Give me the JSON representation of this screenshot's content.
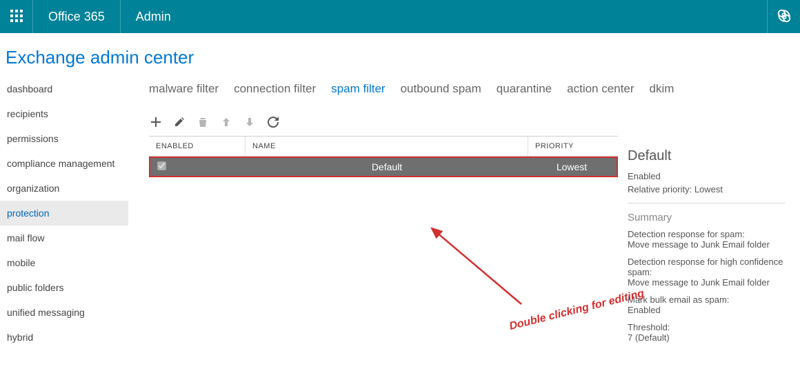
{
  "topbar": {
    "brand": "Office 365",
    "app": "Admin"
  },
  "page_title": "Exchange admin center",
  "sidebar": {
    "items": [
      {
        "label": "dashboard"
      },
      {
        "label": "recipients"
      },
      {
        "label": "permissions"
      },
      {
        "label": "compliance management"
      },
      {
        "label": "organization"
      },
      {
        "label": "protection",
        "active": true
      },
      {
        "label": "mail flow"
      },
      {
        "label": "mobile"
      },
      {
        "label": "public folders"
      },
      {
        "label": "unified messaging"
      },
      {
        "label": "hybrid"
      }
    ]
  },
  "subtabs": {
    "items": [
      {
        "label": "malware filter"
      },
      {
        "label": "connection filter"
      },
      {
        "label": "spam filter",
        "active": true
      },
      {
        "label": "outbound spam"
      },
      {
        "label": "quarantine"
      },
      {
        "label": "action center"
      },
      {
        "label": "dkim"
      }
    ]
  },
  "toolbar": {
    "add": "add",
    "edit": "edit",
    "delete": "delete",
    "move_up": "move up",
    "move_down": "move down",
    "refresh": "refresh"
  },
  "table": {
    "columns": {
      "enabled": "ENABLED",
      "name": "NAME",
      "priority": "PRIORITY"
    },
    "rows": [
      {
        "enabled": true,
        "name": "Default",
        "priority": "Lowest"
      }
    ]
  },
  "annotation": {
    "text": "Double clicking for editing"
  },
  "details": {
    "title": "Default",
    "status": "Enabled",
    "priority_label": "Relative priority:",
    "priority_value": "Lowest",
    "summary_label": "Summary",
    "items": [
      {
        "k": "Detection response for spam:",
        "v": "Move message to Junk Email folder"
      },
      {
        "k": "Detection response for high confidence spam:",
        "v": "Move message to Junk Email folder"
      },
      {
        "k": "Mark bulk email as spam:",
        "v": "Enabled"
      },
      {
        "k": "Threshold:",
        "v": "7 (Default)"
      }
    ]
  }
}
